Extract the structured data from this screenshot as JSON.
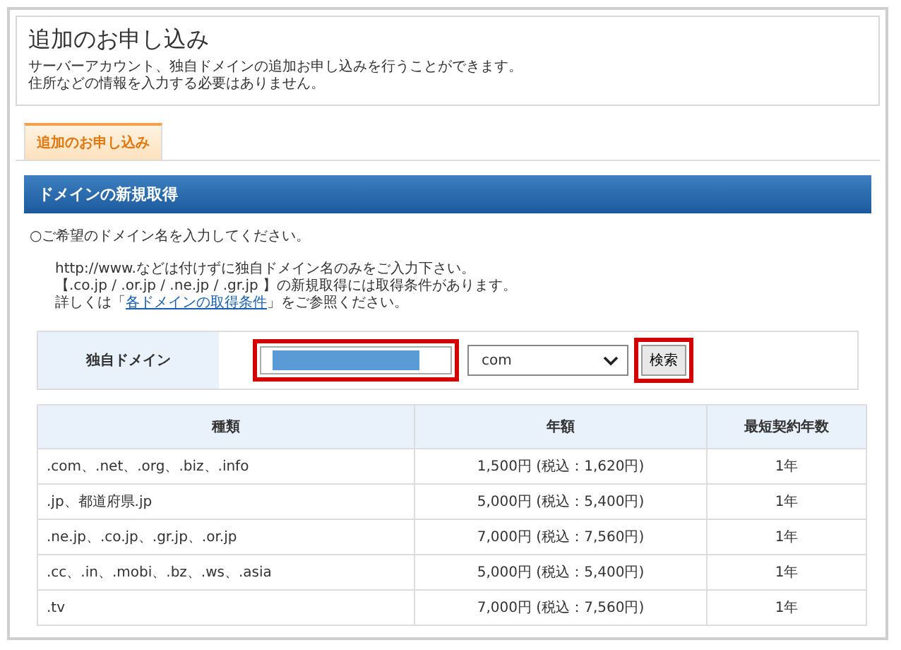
{
  "header": {
    "title": "追加のお申し込み",
    "lines": [
      "サーバーアカウント、独自ドメインの追加お申し込みを行うことができます。",
      "住所などの情報を入力する必要はありません。"
    ]
  },
  "tabs": [
    {
      "label": "追加のお申し込み",
      "selected": true
    }
  ],
  "section": {
    "title": "ドメインの新規取得"
  },
  "instruction": "○ご希望のドメイン名を入力してください。",
  "notes": [
    "http://www.などは付けずに独自ドメイン名のみをご入力下さい。",
    "【.co.jp / .or.jp / .ne.jp / .gr.jp 】の新規取得には取得条件があります。"
  ],
  "detail": {
    "before": "詳しくは「",
    "link": "各ドメインの取得条件",
    "after": "」をご参照ください。"
  },
  "form": {
    "label": "独自ドメイン",
    "select_value": "com",
    "button": "検索"
  },
  "table": {
    "columns": [
      "種類",
      "年額",
      "最短契約年数"
    ],
    "rows": [
      {
        "type": ".com、.net、.org、.biz、.info",
        "price": "1,500円 (税込：1,620円)",
        "term": "1年"
      },
      {
        "type": ".jp、都道府県.jp",
        "price": "5,000円 (税込：5,400円)",
        "term": "1年"
      },
      {
        "type": ".ne.jp、.co.jp、.gr.jp、.or.jp",
        "price": "7,000円 (税込：7,560円)",
        "term": "1年"
      },
      {
        "type": ".cc、.in、.mobi、.bz、.ws、.asia",
        "price": "5,000円 (税込：5,400円)",
        "term": "1年"
      },
      {
        "type": ".tv",
        "price": "7,000円 (税込：7,560円)",
        "term": "1年"
      }
    ]
  }
}
